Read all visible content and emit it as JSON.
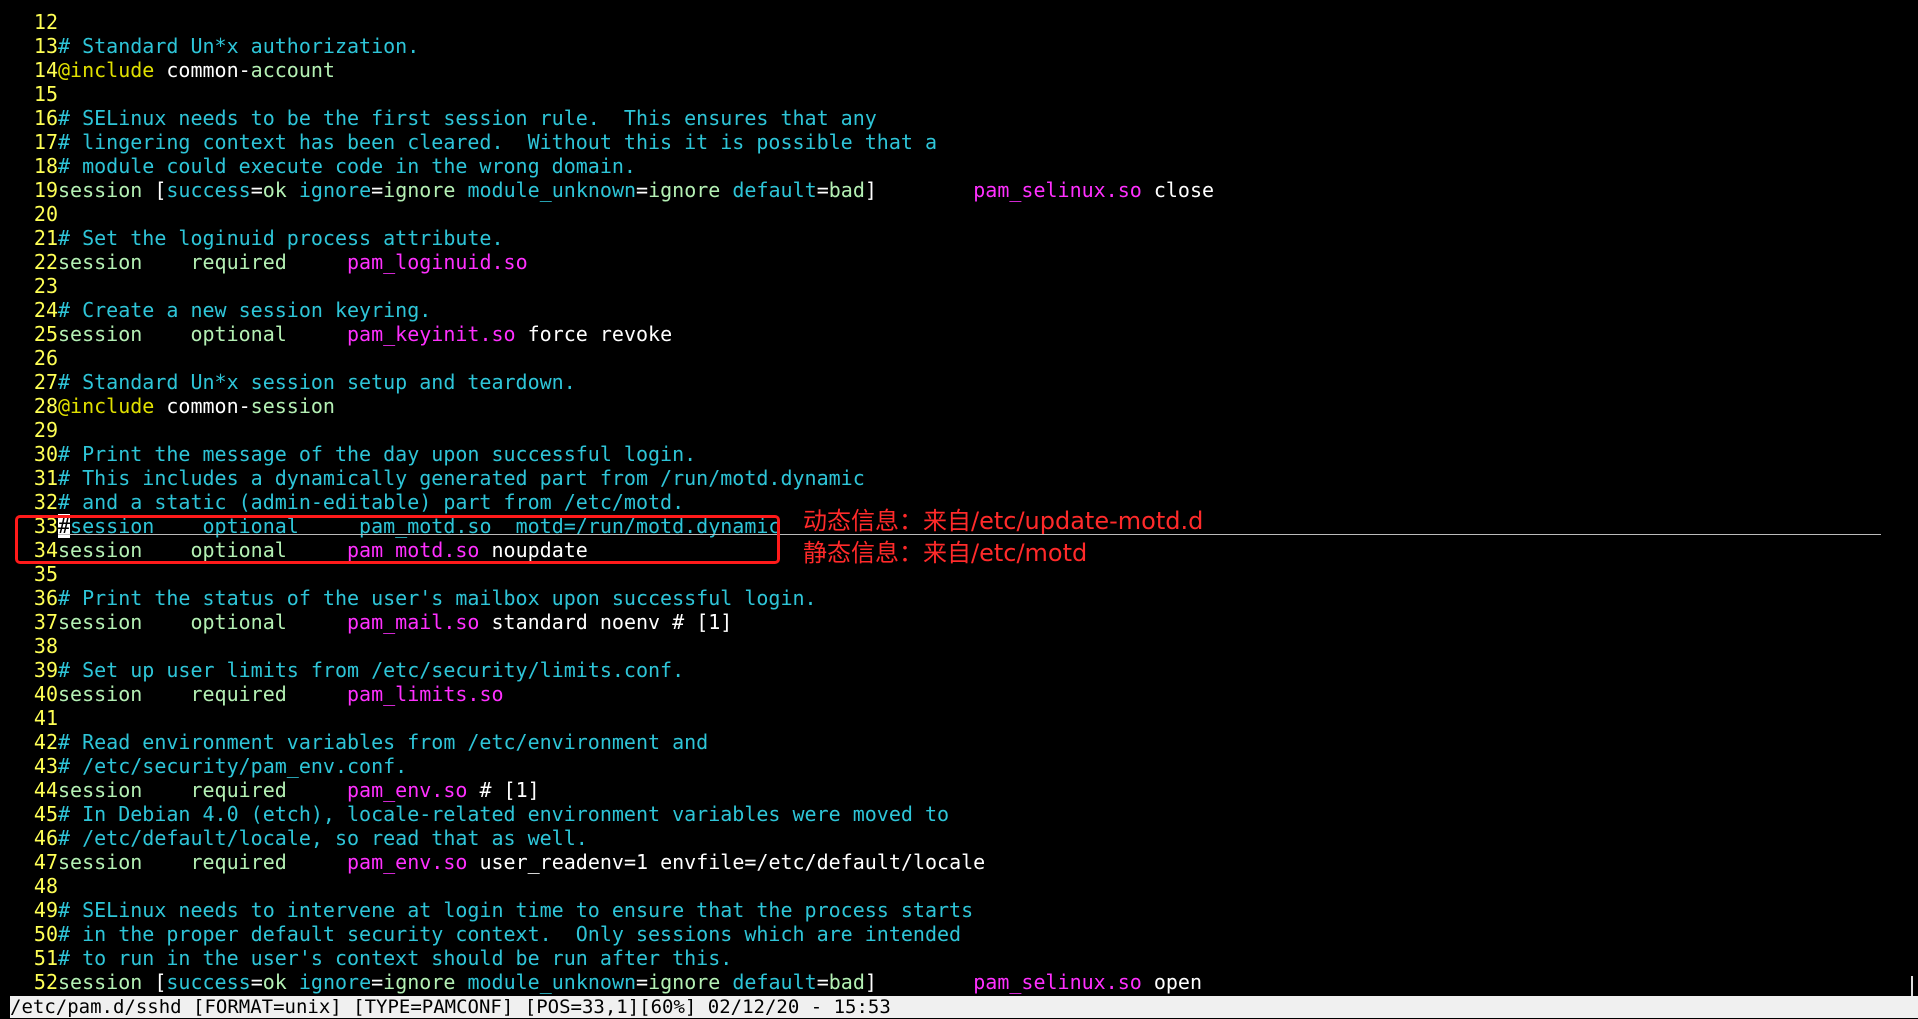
{
  "colors": {
    "background": "#000000",
    "line_number": "#ffff55",
    "comment": "#2ec5d8",
    "keyword": "#b4f0b4",
    "include": "#e0e000",
    "module": "#ff30ff",
    "plain": "#ffffff",
    "annotation": "#ff2a2a",
    "statusbar_bg": "#f0f0f0"
  },
  "lines": [
    {
      "n": "12",
      "tokens": []
    },
    {
      "n": "13",
      "tokens": [
        {
          "t": "# Standard Un*x authorization.",
          "c": "comment"
        }
      ]
    },
    {
      "n": "14",
      "tokens": [
        {
          "t": "@include",
          "c": "include"
        },
        {
          "t": " common-",
          "c": "plain"
        },
        {
          "t": "account",
          "c": "keyword"
        }
      ]
    },
    {
      "n": "15",
      "tokens": []
    },
    {
      "n": "16",
      "tokens": [
        {
          "t": "# SELinux needs to be the first session rule.  This ensures that any",
          "c": "comment"
        }
      ]
    },
    {
      "n": "17",
      "tokens": [
        {
          "t": "# lingering context has been cleared.  Without this it is possible that a",
          "c": "comment"
        }
      ]
    },
    {
      "n": "18",
      "tokens": [
        {
          "t": "# module could execute code in the wrong domain.",
          "c": "comment"
        }
      ]
    },
    {
      "n": "19",
      "tokens": [
        {
          "t": "session",
          "c": "keyword"
        },
        {
          "t": " [",
          "c": "plain"
        },
        {
          "t": "success",
          "c": "cyan"
        },
        {
          "t": "=",
          "c": "plain"
        },
        {
          "t": "ok",
          "c": "keyword"
        },
        {
          "t": " ",
          "c": "plain"
        },
        {
          "t": "ignore",
          "c": "cyan"
        },
        {
          "t": "=",
          "c": "plain"
        },
        {
          "t": "ignore",
          "c": "keyword"
        },
        {
          "t": " ",
          "c": "plain"
        },
        {
          "t": "module_unknown",
          "c": "cyan"
        },
        {
          "t": "=",
          "c": "plain"
        },
        {
          "t": "ignore",
          "c": "keyword"
        },
        {
          "t": " ",
          "c": "plain"
        },
        {
          "t": "default",
          "c": "cyan"
        },
        {
          "t": "=",
          "c": "plain"
        },
        {
          "t": "bad",
          "c": "keyword"
        },
        {
          "t": "]        ",
          "c": "plain"
        },
        {
          "t": "pam_selinux.so",
          "c": "module"
        },
        {
          "t": " close",
          "c": "plain"
        }
      ]
    },
    {
      "n": "20",
      "tokens": []
    },
    {
      "n": "21",
      "tokens": [
        {
          "t": "# Set the loginuid process attribute.",
          "c": "comment"
        }
      ]
    },
    {
      "n": "22",
      "tokens": [
        {
          "t": "session",
          "c": "keyword"
        },
        {
          "t": "    ",
          "c": "plain"
        },
        {
          "t": "required",
          "c": "keyword"
        },
        {
          "t": "     ",
          "c": "plain"
        },
        {
          "t": "pam_loginuid.so",
          "c": "module"
        }
      ]
    },
    {
      "n": "23",
      "tokens": []
    },
    {
      "n": "24",
      "tokens": [
        {
          "t": "# Create a new session keyring.",
          "c": "comment"
        }
      ]
    },
    {
      "n": "25",
      "tokens": [
        {
          "t": "session",
          "c": "keyword"
        },
        {
          "t": "    ",
          "c": "plain"
        },
        {
          "t": "optional",
          "c": "keyword"
        },
        {
          "t": "     ",
          "c": "plain"
        },
        {
          "t": "pam_keyinit.so",
          "c": "module"
        },
        {
          "t": " force revoke",
          "c": "plain"
        }
      ]
    },
    {
      "n": "26",
      "tokens": []
    },
    {
      "n": "27",
      "tokens": [
        {
          "t": "# Standard Un*x session setup and teardown.",
          "c": "comment"
        }
      ]
    },
    {
      "n": "28",
      "tokens": [
        {
          "t": "@include",
          "c": "include"
        },
        {
          "t": " common-",
          "c": "plain"
        },
        {
          "t": "session",
          "c": "keyword"
        }
      ]
    },
    {
      "n": "29",
      "tokens": []
    },
    {
      "n": "30",
      "tokens": [
        {
          "t": "# Print the message of the day upon successful login.",
          "c": "comment"
        }
      ]
    },
    {
      "n": "31",
      "tokens": [
        {
          "t": "# This includes a dynamically generated part from /run/motd.dynamic",
          "c": "comment"
        }
      ]
    },
    {
      "n": "32",
      "tokens": [
        {
          "t": "# and a static (admin-editable) part from /etc/motd.",
          "c": "comment"
        }
      ]
    },
    {
      "n": "33",
      "tokens": [
        {
          "t": "#",
          "c": "cursor"
        },
        {
          "t": "session    optional     pam_motd.so  motd=/run/motd.dynamic",
          "c": "comment"
        }
      ]
    },
    {
      "n": "34",
      "tokens": [
        {
          "t": "session",
          "c": "keyword"
        },
        {
          "t": "    ",
          "c": "plain"
        },
        {
          "t": "optional",
          "c": "keyword"
        },
        {
          "t": "     ",
          "c": "plain"
        },
        {
          "t": "pam_motd.so",
          "c": "module"
        },
        {
          "t": " noupdate",
          "c": "plain"
        }
      ]
    },
    {
      "n": "35",
      "tokens": []
    },
    {
      "n": "36",
      "tokens": [
        {
          "t": "# Print the status of the user's mailbox upon successful login.",
          "c": "comment"
        }
      ]
    },
    {
      "n": "37",
      "tokens": [
        {
          "t": "session",
          "c": "keyword"
        },
        {
          "t": "    ",
          "c": "plain"
        },
        {
          "t": "optional",
          "c": "keyword"
        },
        {
          "t": "     ",
          "c": "plain"
        },
        {
          "t": "pam_mail.so",
          "c": "module"
        },
        {
          "t": " standard noenv # [1]",
          "c": "plain"
        }
      ]
    },
    {
      "n": "38",
      "tokens": []
    },
    {
      "n": "39",
      "tokens": [
        {
          "t": "# Set up user limits from /etc/security/limits.conf.",
          "c": "comment"
        }
      ]
    },
    {
      "n": "40",
      "tokens": [
        {
          "t": "session",
          "c": "keyword"
        },
        {
          "t": "    ",
          "c": "plain"
        },
        {
          "t": "required",
          "c": "keyword"
        },
        {
          "t": "     ",
          "c": "plain"
        },
        {
          "t": "pam_limits.so",
          "c": "module"
        }
      ]
    },
    {
      "n": "41",
      "tokens": []
    },
    {
      "n": "42",
      "tokens": [
        {
          "t": "# Read environment variables from /etc/environment and",
          "c": "comment"
        }
      ]
    },
    {
      "n": "43",
      "tokens": [
        {
          "t": "# /etc/security/pam_env.conf.",
          "c": "comment"
        }
      ]
    },
    {
      "n": "44",
      "tokens": [
        {
          "t": "session",
          "c": "keyword"
        },
        {
          "t": "    ",
          "c": "plain"
        },
        {
          "t": "required",
          "c": "keyword"
        },
        {
          "t": "     ",
          "c": "plain"
        },
        {
          "t": "pam_env.so",
          "c": "module"
        },
        {
          "t": " # [1]",
          "c": "plain"
        }
      ]
    },
    {
      "n": "45",
      "tokens": [
        {
          "t": "# In Debian 4.0 (etch), locale-related environment variables were moved to",
          "c": "comment"
        }
      ]
    },
    {
      "n": "46",
      "tokens": [
        {
          "t": "# /etc/default/locale, so read that as well.",
          "c": "comment"
        }
      ]
    },
    {
      "n": "47",
      "tokens": [
        {
          "t": "session",
          "c": "keyword"
        },
        {
          "t": "    ",
          "c": "plain"
        },
        {
          "t": "required",
          "c": "keyword"
        },
        {
          "t": "     ",
          "c": "plain"
        },
        {
          "t": "pam_env.so",
          "c": "module"
        },
        {
          "t": " user_readenv=1 envfile=/etc/default/locale",
          "c": "plain"
        }
      ]
    },
    {
      "n": "48",
      "tokens": []
    },
    {
      "n": "49",
      "tokens": [
        {
          "t": "# SELinux needs to intervene at login time to ensure that the process starts",
          "c": "comment"
        }
      ]
    },
    {
      "n": "50",
      "tokens": [
        {
          "t": "# in the proper default security context.  Only sessions which are intended",
          "c": "comment"
        }
      ]
    },
    {
      "n": "51",
      "tokens": [
        {
          "t": "# to run in the user's context should be run after this.",
          "c": "comment"
        }
      ]
    },
    {
      "n": "52",
      "tokens": [
        {
          "t": "session",
          "c": "keyword"
        },
        {
          "t": " [",
          "c": "plain"
        },
        {
          "t": "success",
          "c": "cyan"
        },
        {
          "t": "=",
          "c": "plain"
        },
        {
          "t": "ok",
          "c": "keyword"
        },
        {
          "t": " ",
          "c": "plain"
        },
        {
          "t": "ignore",
          "c": "cyan"
        },
        {
          "t": "=",
          "c": "plain"
        },
        {
          "t": "ignore",
          "c": "keyword"
        },
        {
          "t": " ",
          "c": "plain"
        },
        {
          "t": "module_unknown",
          "c": "cyan"
        },
        {
          "t": "=",
          "c": "plain"
        },
        {
          "t": "ignore",
          "c": "keyword"
        },
        {
          "t": " ",
          "c": "plain"
        },
        {
          "t": "default",
          "c": "cyan"
        },
        {
          "t": "=",
          "c": "plain"
        },
        {
          "t": "bad",
          "c": "keyword"
        },
        {
          "t": "]        ",
          "c": "plain"
        },
        {
          "t": "pam_selinux.so",
          "c": "module"
        },
        {
          "t": " open",
          "c": "plain"
        }
      ]
    }
  ],
  "annotations": {
    "dynamic": "动态信息：来自/etc/update-motd.d",
    "static": "静态信息：来自/etc/motd"
  },
  "statusbar": {
    "text": "/etc/pam.d/sshd [FORMAT=unix] [TYPE=PAMCONF] [POS=33,1][60%] 02/12/20 - 15:53"
  }
}
